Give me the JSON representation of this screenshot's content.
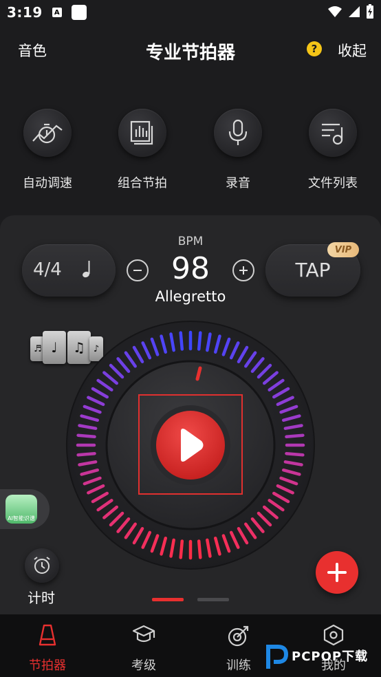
{
  "status_bar": {
    "time": "3:19",
    "a_icon": "A"
  },
  "header": {
    "left": "音色",
    "title": "专业节拍器",
    "help": "?",
    "right": "收起"
  },
  "tools": [
    {
      "label": "自动调速",
      "icon": "auto-speed-icon"
    },
    {
      "label": "组合节拍",
      "icon": "combined-beat-icon"
    },
    {
      "label": "录音",
      "icon": "microphone-icon"
    },
    {
      "label": "文件列表",
      "icon": "file-list-icon"
    }
  ],
  "metronome": {
    "time_signature": "4/4",
    "note_glyph": "♩",
    "bpm_label": "BPM",
    "bpm": "98",
    "tempo_name": "Allegretto",
    "tap_label": "TAP",
    "vip_label": "VIP",
    "minus": "−",
    "plus": "+"
  },
  "ai_badge": {
    "label": "AI智能识谱"
  },
  "timer": {
    "label": "计时"
  },
  "pager": {
    "active_index": 0,
    "count": 2
  },
  "tabbar": [
    {
      "label": "节拍器",
      "icon": "metronome-icon",
      "active": true
    },
    {
      "label": "考级",
      "icon": "graduation-cap-icon",
      "active": false
    },
    {
      "label": "训练",
      "icon": "target-icon",
      "active": false
    },
    {
      "label": "我的",
      "icon": "hexagon-settings-icon",
      "active": false
    }
  ],
  "watermark": {
    "text": "PCPOP下载"
  },
  "colors": {
    "accent": "#e8302f",
    "background": "#1c1c1e",
    "panel": "#262628",
    "vip": "#f3d6a5"
  }
}
